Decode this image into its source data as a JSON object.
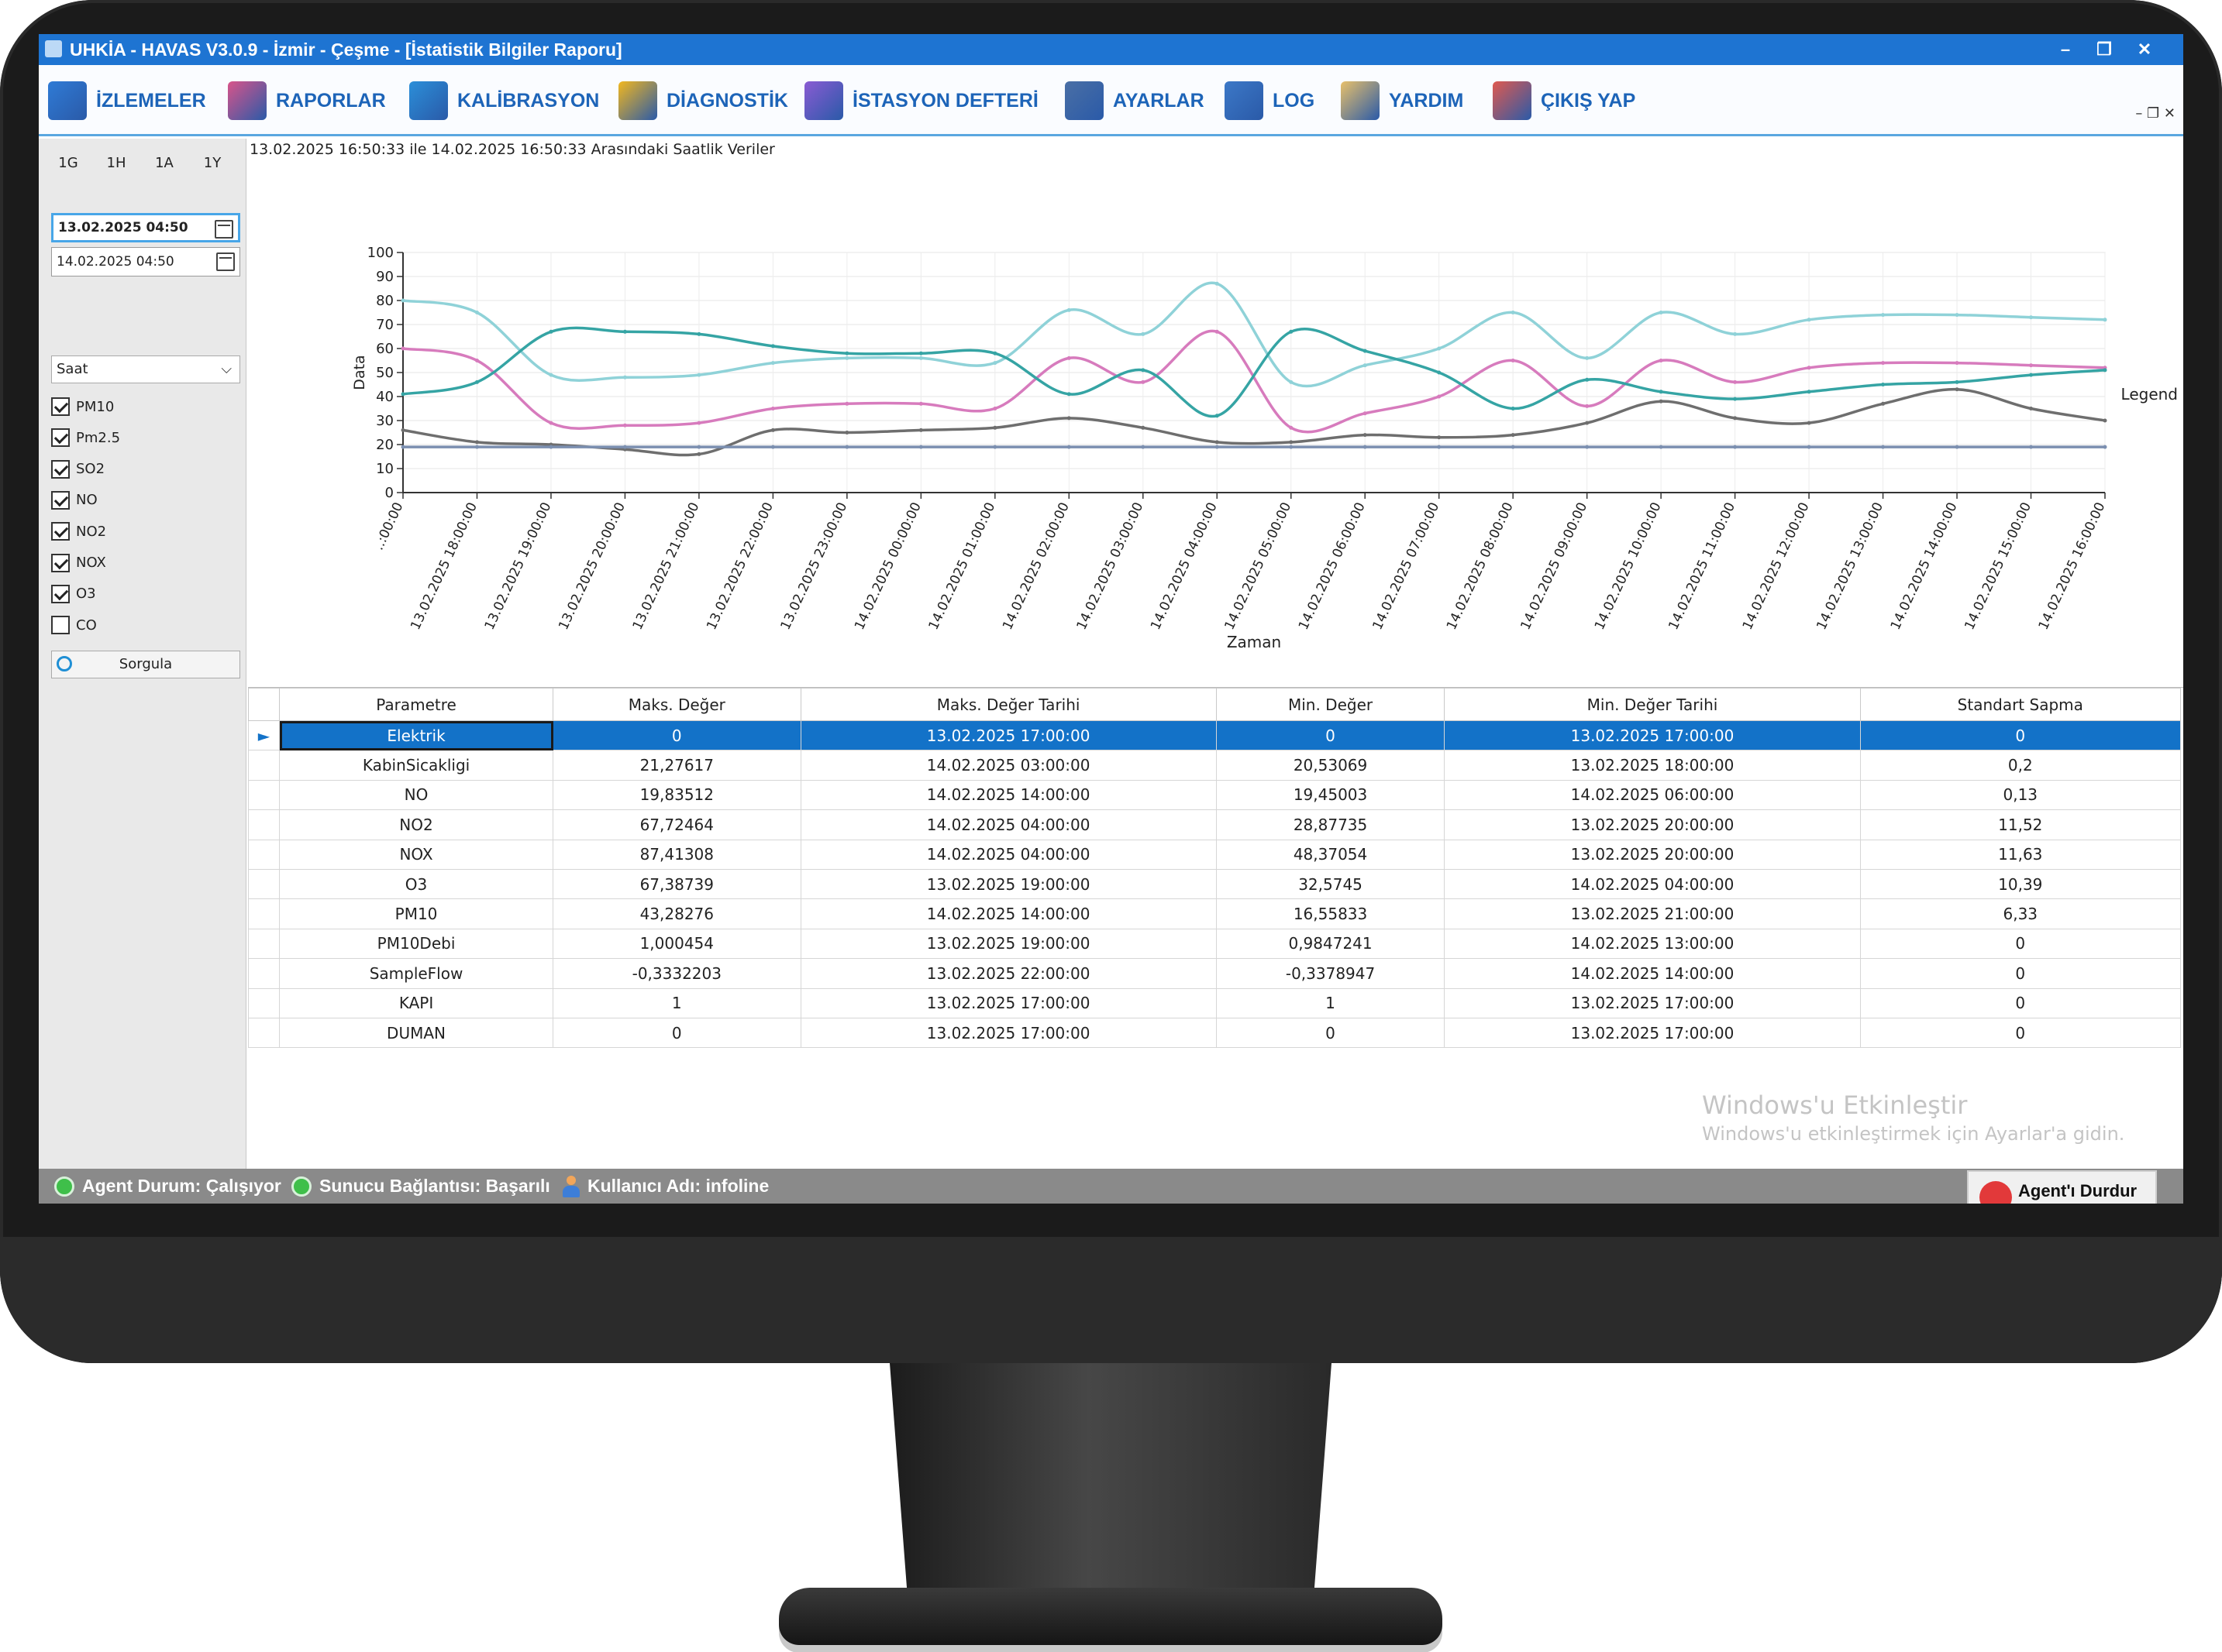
{
  "window": {
    "title": "UHKİA - HAVAS V3.0.9 - İzmir - Çeşme - [İstatistik Bilgiler Raporu]",
    "min_glyph": "–",
    "restore_glyph": "❐",
    "close_glyph": "✕"
  },
  "menu": {
    "items": [
      {
        "label": "İZLEMELER",
        "icon": "monitor-list-icon",
        "color": "#2f7bd6"
      },
      {
        "label": "RAPORLAR",
        "icon": "report-chart-icon",
        "color": "#d9548a"
      },
      {
        "label": "KALİBRASYON",
        "icon": "calibration-clock-icon",
        "color": "#2b8fd9"
      },
      {
        "label": "DİAGNOSTİK",
        "icon": "diagnostic-warning-icon",
        "color": "#f2b71f"
      },
      {
        "label": "İSTASYON DEFTERİ",
        "icon": "station-log-icon",
        "color": "#8a5bd3"
      },
      {
        "label": "AYARLAR",
        "icon": "settings-server-icon",
        "color": "#4a6fa5"
      },
      {
        "label": "LOG",
        "icon": "log-file-icon",
        "color": "#3c78c7"
      },
      {
        "label": "YARDIM",
        "icon": "help-question-icon",
        "color": "#e8c06a"
      },
      {
        "label": "ÇIKIŞ YAP",
        "icon": "logout-user-icon",
        "color": "#e05a4f"
      }
    ],
    "mdi_controls": "–  ❐  ✕"
  },
  "sidebar": {
    "quick_ranges": [
      "1G",
      "1H",
      "1A",
      "1Y"
    ],
    "start_date": "13.02.2025 04:50",
    "end_date": "14.02.2025 04:50",
    "period": "Saat",
    "parameters": [
      {
        "label": "PM10",
        "checked": true
      },
      {
        "label": "Pm2.5",
        "checked": true
      },
      {
        "label": "SO2",
        "checked": true
      },
      {
        "label": "NO",
        "checked": true
      },
      {
        "label": "NO2",
        "checked": true
      },
      {
        "label": "NOX",
        "checked": true
      },
      {
        "label": "O3",
        "checked": true
      },
      {
        "label": "CO",
        "checked": false
      }
    ],
    "query_label": "Sorgula"
  },
  "range_label": "13.02.2025 16:50:33 ile 14.02.2025 16:50:33 Arasındaki Saatlik Veriler",
  "chart_data": {
    "type": "line",
    "xlabel": "Zaman",
    "ylabel": "Data",
    "legend_text": "Legend",
    "legend_position": "right",
    "ylim": [
      0,
      100
    ],
    "yticks": [
      0,
      10,
      20,
      30,
      40,
      50,
      60,
      70,
      80,
      90,
      100
    ],
    "grid": true,
    "x": [
      "..:00:00",
      "13.02.2025 18:00:00",
      "13.02.2025 19:00:00",
      "13.02.2025 20:00:00",
      "13.02.2025 21:00:00",
      "13.02.2025 22:00:00",
      "13.02.2025 23:00:00",
      "14.02.2025 00:00:00",
      "14.02.2025 01:00:00",
      "14.02.2025 02:00:00",
      "14.02.2025 03:00:00",
      "14.02.2025 04:00:00",
      "14.02.2025 05:00:00",
      "14.02.2025 06:00:00",
      "14.02.2025 07:00:00",
      "14.02.2025 08:00:00",
      "14.02.2025 09:00:00",
      "14.02.2025 10:00:00",
      "14.02.2025 11:00:00",
      "14.02.2025 12:00:00",
      "14.02.2025 13:00:00",
      "14.02.2025 14:00:00",
      "14.02.2025 15:00:00",
      "14.02.2025 16:00:00"
    ],
    "series": [
      {
        "color": "#8fd2d8",
        "values": [
          80,
          75,
          49,
          48,
          49,
          54,
          56,
          56,
          54,
          76,
          66,
          87,
          46,
          53,
          60,
          75,
          56,
          75,
          66,
          72,
          74,
          74,
          73,
          72
        ]
      },
      {
        "color": "#d77bbd",
        "values": [
          60,
          55,
          29,
          28,
          29,
          35,
          37,
          37,
          35,
          56,
          46,
          67,
          27,
          33,
          40,
          55,
          36,
          55,
          46,
          52,
          54,
          54,
          53,
          52
        ]
      },
      {
        "color": "#35a4a4",
        "values": [
          41,
          46,
          67,
          67,
          66,
          61,
          58,
          58,
          58,
          41,
          51,
          32,
          67,
          59,
          50,
          35,
          47,
          42,
          39,
          42,
          45,
          46,
          49,
          51
        ]
      },
      {
        "color": "#6e6e6e",
        "values": [
          26,
          21,
          20,
          18,
          16,
          26,
          25,
          26,
          27,
          31,
          27,
          21,
          21,
          24,
          23,
          24,
          29,
          38,
          31,
          29,
          37,
          43,
          35,
          30
        ]
      },
      {
        "color": "#7b8fb0",
        "values": [
          19,
          19,
          19,
          19,
          19,
          19,
          19,
          19,
          19,
          19,
          19,
          19,
          19,
          19,
          19,
          19,
          19,
          19,
          19,
          19,
          19,
          19,
          19,
          19
        ]
      }
    ]
  },
  "table": {
    "columns": [
      "Parametre",
      "Maks. Değer",
      "Maks. Değer Tarihi",
      "Min. Değer",
      "Min. Değer Tarihi",
      "Standart Sapma"
    ],
    "rows": [
      [
        "Elektrik",
        "0",
        "13.02.2025 17:00:00",
        "0",
        "13.02.2025 17:00:00",
        "0"
      ],
      [
        "KabinSicakligi",
        "21,27617",
        "14.02.2025 03:00:00",
        "20,53069",
        "13.02.2025 18:00:00",
        "0,2"
      ],
      [
        "NO",
        "19,83512",
        "14.02.2025 14:00:00",
        "19,45003",
        "14.02.2025 06:00:00",
        "0,13"
      ],
      [
        "NO2",
        "67,72464",
        "14.02.2025 04:00:00",
        "28,87735",
        "13.02.2025 20:00:00",
        "11,52"
      ],
      [
        "NOX",
        "87,41308",
        "14.02.2025 04:00:00",
        "48,37054",
        "13.02.2025 20:00:00",
        "11,63"
      ],
      [
        "O3",
        "67,38739",
        "13.02.2025 19:00:00",
        "32,5745",
        "14.02.2025 04:00:00",
        "10,39"
      ],
      [
        "PM10",
        "43,28276",
        "14.02.2025 14:00:00",
        "16,55833",
        "13.02.2025 21:00:00",
        "6,33"
      ],
      [
        "PM10Debi",
        "1,000454",
        "13.02.2025 19:00:00",
        "0,9847241",
        "14.02.2025 13:00:00",
        "0"
      ],
      [
        "SampleFlow",
        "-0,3332203",
        "13.02.2025 22:00:00",
        "-0,3378947",
        "14.02.2025 14:00:00",
        "0"
      ],
      [
        "KAPI",
        "1",
        "13.02.2025 17:00:00",
        "1",
        "13.02.2025 17:00:00",
        "0"
      ],
      [
        "DUMAN",
        "0",
        "13.02.2025 17:00:00",
        "0",
        "13.02.2025 17:00:00",
        "0"
      ]
    ],
    "selected_row": 0,
    "row_marker": "►"
  },
  "watermark": {
    "title": "Windows'u Etkinleştir",
    "subtitle": "Windows'u etkinleştirmek için Ayarlar'a gidin."
  },
  "status": {
    "agent": "Agent Durum: Çalışıyor",
    "server": "Sunucu Bağlantısı: Başarılı",
    "user": "Kullanıcı Adı: infoline",
    "stop_button": "Agent'ı Durdur"
  }
}
